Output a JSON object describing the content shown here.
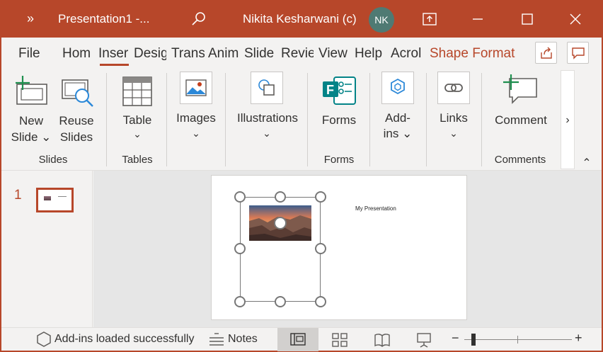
{
  "title_bar": {
    "overflow_glyph": "»",
    "doc_title": "Presentation1  -...",
    "user_name": "Nikita Kesharwani (c)",
    "avatar_initials": "NK",
    "accent": "#b7472a"
  },
  "tabs": [
    {
      "label": "File"
    },
    {
      "label": "Hom"
    },
    {
      "label": "Inser"
    },
    {
      "label": "Desig"
    },
    {
      "label": "Trans"
    },
    {
      "label": "Anim"
    },
    {
      "label": "Slide"
    },
    {
      "label": "Revie"
    },
    {
      "label": "View"
    },
    {
      "label": "Help"
    },
    {
      "label": "Acrol"
    },
    {
      "label": "Shape Format"
    }
  ],
  "ribbon": {
    "new_slide": [
      "New",
      "Slide ⌄"
    ],
    "reuse_slides": [
      "Reuse",
      "Slides"
    ],
    "group_slides": "Slides",
    "table": "Table",
    "table_chevron": "⌄",
    "group_tables": "Tables",
    "images": "Images",
    "images_chevron": "⌄",
    "illustrations": "Illustrations",
    "illustrations_chevron": "⌄",
    "forms": "Forms",
    "group_forms": "Forms",
    "addins": [
      "Add-",
      "ins ⌄"
    ],
    "links": "Links",
    "links_chevron": "⌄",
    "comment": "Comment",
    "group_comments": "Comments",
    "scroll_right": "›",
    "collapse": "⌃"
  },
  "slide_panel": {
    "slide_number": "1"
  },
  "slide": {
    "title_text": "My Presentation"
  },
  "status_bar": {
    "addins_status": "Add-ins loaded successfully",
    "notes_label": "Notes",
    "zoom_minus": "−",
    "zoom_plus": "+"
  }
}
